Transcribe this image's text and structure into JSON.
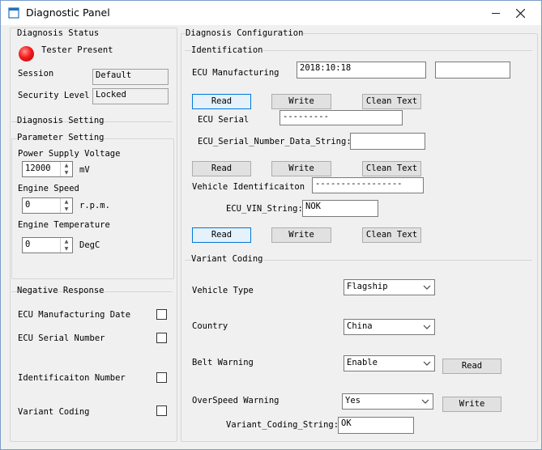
{
  "window": {
    "title": "Diagnostic Panel"
  },
  "status": {
    "group_title": "Diagnosis Status",
    "tester_present": "Tester Present",
    "session_label": "Session",
    "session_value": "Default",
    "security_label": "Security Level",
    "security_value": "Locked",
    "led_color": "#f31c1c"
  },
  "setting": {
    "group_title": "Diagnosis Setting",
    "param_title": "Parameter Setting",
    "psv_label": "Power Supply Voltage",
    "psv_value": "12000",
    "psv_unit": "mV",
    "speed_label": "Engine Speed",
    "speed_value": "0",
    "speed_unit": "r.p.m.",
    "temp_label": "Engine Temperature",
    "temp_value": "0",
    "temp_unit": "DegC"
  },
  "negative": {
    "group_title": "Negative Response",
    "items": [
      "ECU Manufacturing Date",
      "ECU Serial Number",
      "Identificaiton Number",
      "Variant Coding"
    ]
  },
  "config": {
    "group_title": "Diagnosis Configuration",
    "ident_title": "Identification",
    "ecu_mfg_label": "ECU Manufacturing",
    "ecu_mfg_value": "2018:10:18",
    "ecu_mfg_value2": "",
    "read": "Read",
    "write": "Write",
    "clean": "Clean Text",
    "ecu_serial_label": "ECU Serial",
    "ecu_serial_value": "---------",
    "ecu_serial_str_label": "ECU_Serial_Number_Data_String:",
    "ecu_serial_str_value": "",
    "vin_label": "Vehicle Identificaiton",
    "vin_value": "-----------------",
    "vin_str_label": "ECU_VIN_String:",
    "vin_str_value": "NOK"
  },
  "variant": {
    "group_title": "Variant Coding",
    "vehicle_type_label": "Vehicle Type",
    "vehicle_type_value": "Flagship",
    "country_label": "Country",
    "country_value": "China",
    "belt_label": "Belt Warning",
    "belt_value": "Enable",
    "overspeed_label": "OverSpeed Warning",
    "overspeed_value": "Yes",
    "read": "Read",
    "write": "Write",
    "vc_string_label": "Variant_Coding_String:",
    "vc_string_value": "OK"
  }
}
